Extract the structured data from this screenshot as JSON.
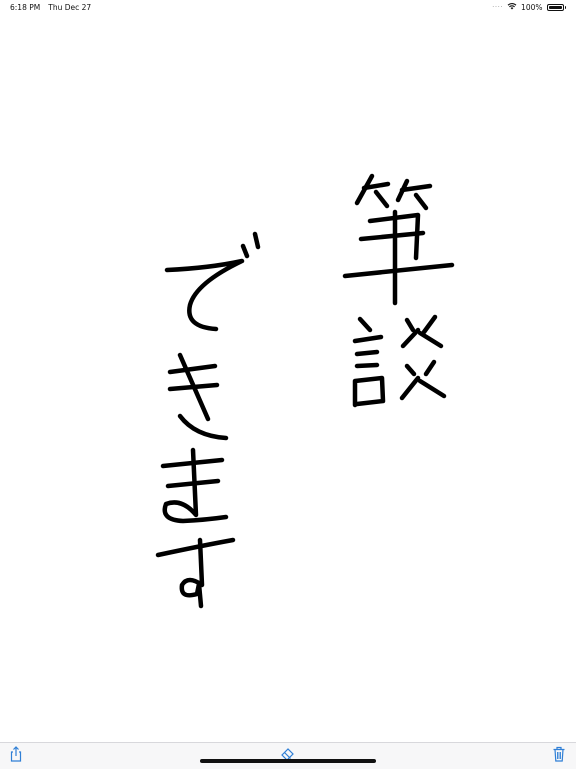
{
  "status_bar": {
    "time": "6:18 PM",
    "date": "Thu Dec 27",
    "signal_icon": "cellular-dots-icon",
    "wifi_icon": "wifi-icon",
    "battery_percent": "100%",
    "battery_level": 1.0
  },
  "canvas": {
    "handwritten_text_column_1": "筆談",
    "handwritten_text_column_2": "できます",
    "ink_color": "#000000"
  },
  "toolbar": {
    "share_icon": "share-icon",
    "eraser_icon": "eraser-icon",
    "trash_icon": "trash-icon",
    "accent_color": "#2f7fd6"
  }
}
